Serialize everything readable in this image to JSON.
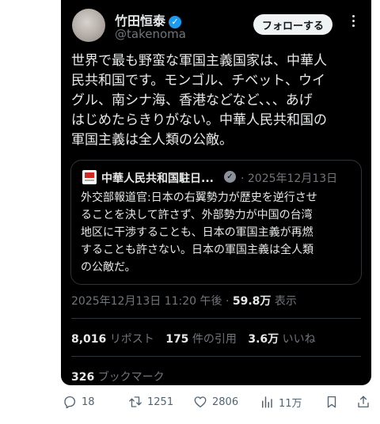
{
  "author": {
    "name": "竹田恒泰",
    "handle": "@takenoma",
    "follow_label": "フォローする"
  },
  "tweet": {
    "text": "世界で最も野蛮な軍国主義国家は、中華人\n民共和国です。モンゴル、チベット、ウイ\nグル、南シナ海、香港などなど、、、あげ\nはじめたらきりがない。中華人民共和国の\n軍国主義は全人類の公敵。"
  },
  "quote": {
    "name": "中華人民共和国駐日...",
    "date": "· 2025年12月13日",
    "text": "外交部報道官:日本の右翼勢力が歴史を逆行させ\nることを決して許さず、外部勢力が中国の台湾\n地区に干渉することも、日本の軍国主義が再燃\nすることも許さない。日本の軍国主義は全人類\nの公敵だ。"
  },
  "meta": {
    "timestamp": "2025年12月13日 11:20 午後 ·",
    "views": "59.8万",
    "views_label": "表示"
  },
  "stats": {
    "reposts": "8,016",
    "reposts_label": "リポスト",
    "quotes": "175",
    "quotes_label": "件の引用",
    "likes": "3.6万",
    "likes_label": "いいね",
    "bookmarks": "326",
    "bookmarks_label": "ブックマーク"
  },
  "actions": {
    "replies": "18",
    "retweets": "1251",
    "likes": "2806",
    "views": "11万"
  },
  "colors": {
    "background": "#000000",
    "text": "#e7e9ea",
    "muted": "#71767b",
    "verified": "#1d9bf0",
    "action_icons": "#536471"
  }
}
